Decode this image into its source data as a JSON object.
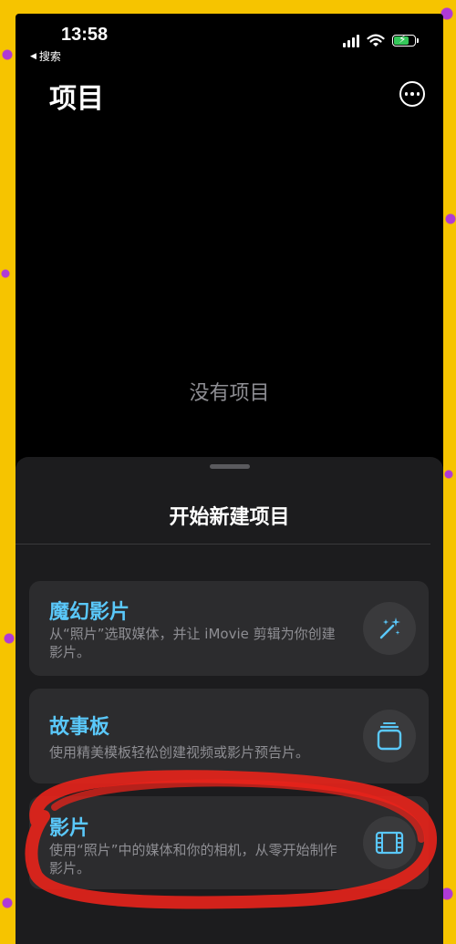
{
  "status_bar": {
    "time": "13:58",
    "back_label": "搜索",
    "battery_charging": true
  },
  "header": {
    "title": "项目",
    "more_icon": "ellipsis-circle-icon"
  },
  "empty_state": {
    "text": "没有项目"
  },
  "sheet": {
    "title": "开始新建项目",
    "options": [
      {
        "title": "魔幻影片",
        "description": "从“照片”选取媒体，并让 iMovie 剪辑为你创建影片。",
        "icon": "magic-wand-icon"
      },
      {
        "title": "故事板",
        "description": "使用精美模板轻松创建视频或影片预告片。",
        "icon": "storyboard-icon"
      },
      {
        "title": "影片",
        "description": "使用“照片”中的媒体和你的相机，从零开始制作影片。",
        "icon": "film-icon"
      }
    ]
  },
  "colors": {
    "accent": "#5ac8fa",
    "annotation": "#e8231b",
    "frame": "#f6c400"
  }
}
